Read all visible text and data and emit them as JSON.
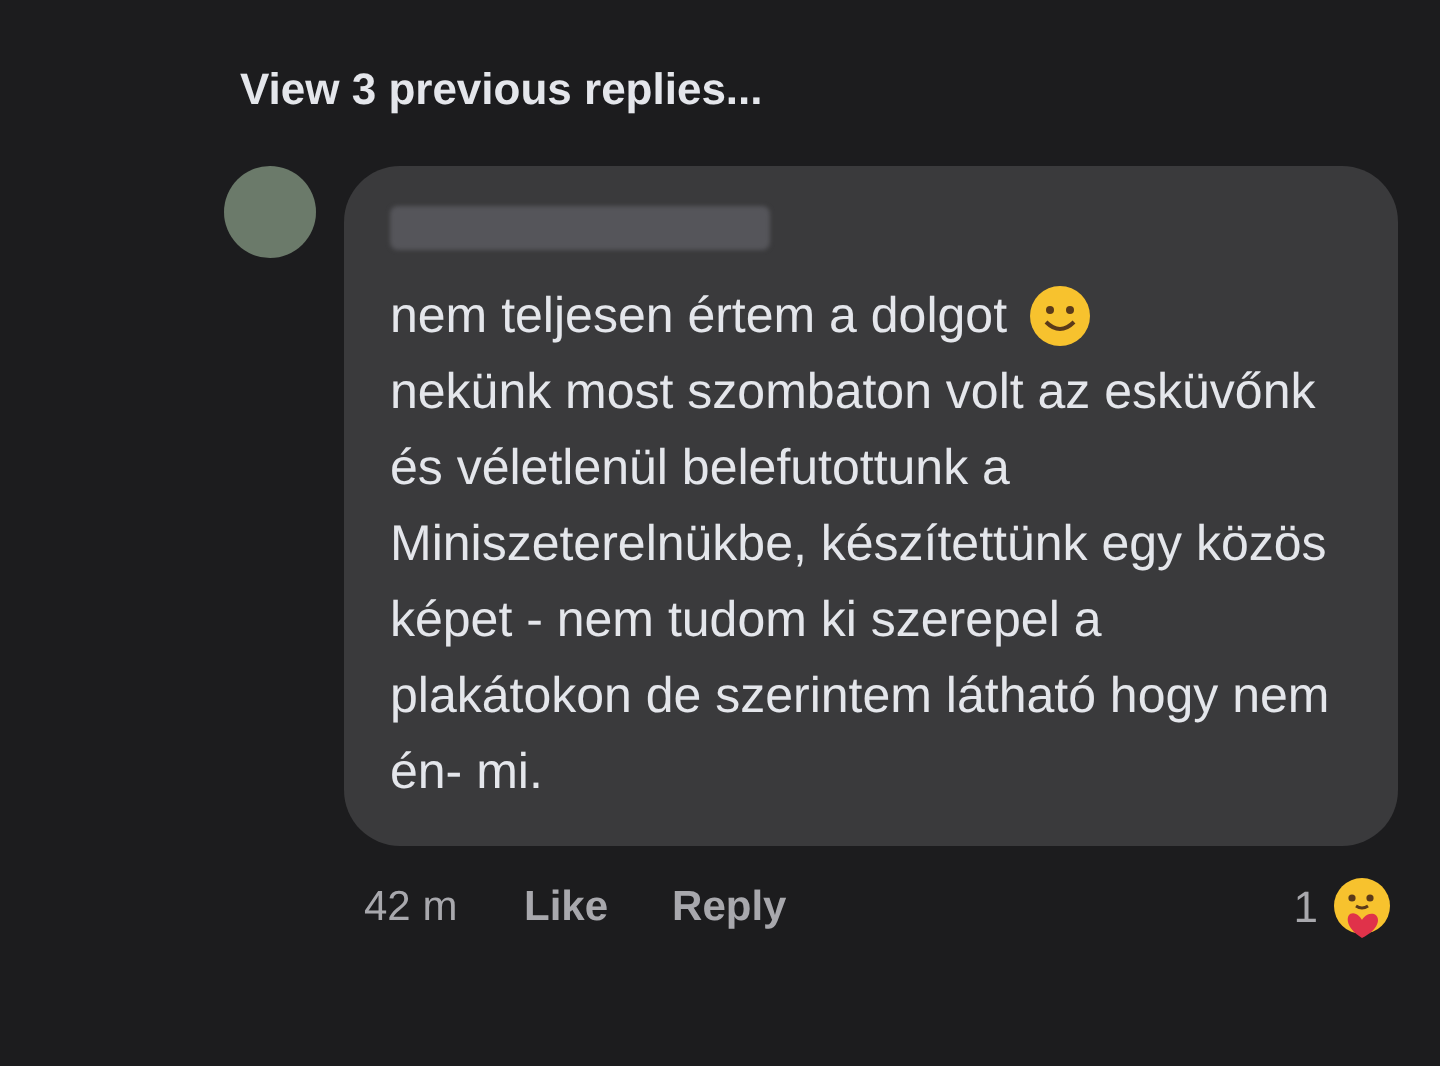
{
  "previous_replies_link": "View 3 previous replies...",
  "comment": {
    "first_line": "nem teljesen értem a dolgot",
    "body": "nekünk most szombaton volt az esküvőnk és véletlenül belefutottunk a Miniszeterelnükbe, készítettünk egy közös képet - nem tudom ki szerepel a plakátokon de szerintem látható hogy nem én- mi.",
    "time": "42 m",
    "actions": [
      "Like",
      "Reply"
    ],
    "reaction_count": "1"
  }
}
